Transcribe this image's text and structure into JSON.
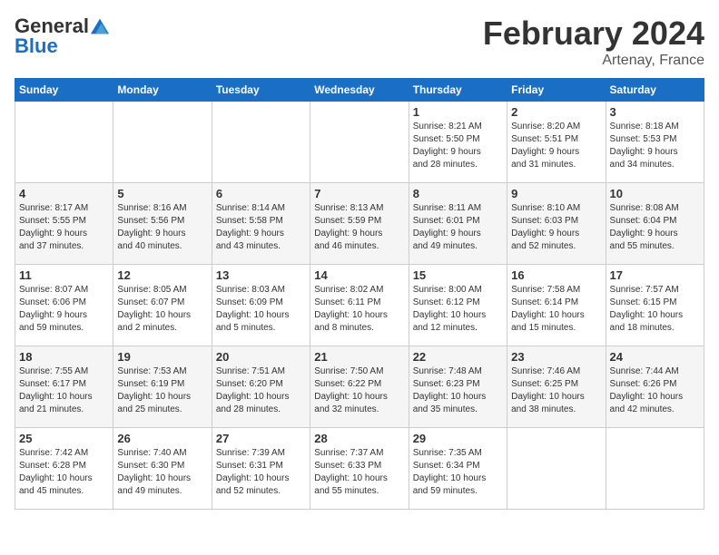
{
  "header": {
    "logo_line1": "General",
    "logo_line2": "Blue",
    "month_title": "February 2024",
    "location": "Artenay, France"
  },
  "days_of_week": [
    "Sunday",
    "Monday",
    "Tuesday",
    "Wednesday",
    "Thursday",
    "Friday",
    "Saturday"
  ],
  "weeks": [
    [
      {
        "day": "",
        "info": ""
      },
      {
        "day": "",
        "info": ""
      },
      {
        "day": "",
        "info": ""
      },
      {
        "day": "",
        "info": ""
      },
      {
        "day": "1",
        "info": "Sunrise: 8:21 AM\nSunset: 5:50 PM\nDaylight: 9 hours\nand 28 minutes."
      },
      {
        "day": "2",
        "info": "Sunrise: 8:20 AM\nSunset: 5:51 PM\nDaylight: 9 hours\nand 31 minutes."
      },
      {
        "day": "3",
        "info": "Sunrise: 8:18 AM\nSunset: 5:53 PM\nDaylight: 9 hours\nand 34 minutes."
      }
    ],
    [
      {
        "day": "4",
        "info": "Sunrise: 8:17 AM\nSunset: 5:55 PM\nDaylight: 9 hours\nand 37 minutes."
      },
      {
        "day": "5",
        "info": "Sunrise: 8:16 AM\nSunset: 5:56 PM\nDaylight: 9 hours\nand 40 minutes."
      },
      {
        "day": "6",
        "info": "Sunrise: 8:14 AM\nSunset: 5:58 PM\nDaylight: 9 hours\nand 43 minutes."
      },
      {
        "day": "7",
        "info": "Sunrise: 8:13 AM\nSunset: 5:59 PM\nDaylight: 9 hours\nand 46 minutes."
      },
      {
        "day": "8",
        "info": "Sunrise: 8:11 AM\nSunset: 6:01 PM\nDaylight: 9 hours\nand 49 minutes."
      },
      {
        "day": "9",
        "info": "Sunrise: 8:10 AM\nSunset: 6:03 PM\nDaylight: 9 hours\nand 52 minutes."
      },
      {
        "day": "10",
        "info": "Sunrise: 8:08 AM\nSunset: 6:04 PM\nDaylight: 9 hours\nand 55 minutes."
      }
    ],
    [
      {
        "day": "11",
        "info": "Sunrise: 8:07 AM\nSunset: 6:06 PM\nDaylight: 9 hours\nand 59 minutes."
      },
      {
        "day": "12",
        "info": "Sunrise: 8:05 AM\nSunset: 6:07 PM\nDaylight: 10 hours\nand 2 minutes."
      },
      {
        "day": "13",
        "info": "Sunrise: 8:03 AM\nSunset: 6:09 PM\nDaylight: 10 hours\nand 5 minutes."
      },
      {
        "day": "14",
        "info": "Sunrise: 8:02 AM\nSunset: 6:11 PM\nDaylight: 10 hours\nand 8 minutes."
      },
      {
        "day": "15",
        "info": "Sunrise: 8:00 AM\nSunset: 6:12 PM\nDaylight: 10 hours\nand 12 minutes."
      },
      {
        "day": "16",
        "info": "Sunrise: 7:58 AM\nSunset: 6:14 PM\nDaylight: 10 hours\nand 15 minutes."
      },
      {
        "day": "17",
        "info": "Sunrise: 7:57 AM\nSunset: 6:15 PM\nDaylight: 10 hours\nand 18 minutes."
      }
    ],
    [
      {
        "day": "18",
        "info": "Sunrise: 7:55 AM\nSunset: 6:17 PM\nDaylight: 10 hours\nand 21 minutes."
      },
      {
        "day": "19",
        "info": "Sunrise: 7:53 AM\nSunset: 6:19 PM\nDaylight: 10 hours\nand 25 minutes."
      },
      {
        "day": "20",
        "info": "Sunrise: 7:51 AM\nSunset: 6:20 PM\nDaylight: 10 hours\nand 28 minutes."
      },
      {
        "day": "21",
        "info": "Sunrise: 7:50 AM\nSunset: 6:22 PM\nDaylight: 10 hours\nand 32 minutes."
      },
      {
        "day": "22",
        "info": "Sunrise: 7:48 AM\nSunset: 6:23 PM\nDaylight: 10 hours\nand 35 minutes."
      },
      {
        "day": "23",
        "info": "Sunrise: 7:46 AM\nSunset: 6:25 PM\nDaylight: 10 hours\nand 38 minutes."
      },
      {
        "day": "24",
        "info": "Sunrise: 7:44 AM\nSunset: 6:26 PM\nDaylight: 10 hours\nand 42 minutes."
      }
    ],
    [
      {
        "day": "25",
        "info": "Sunrise: 7:42 AM\nSunset: 6:28 PM\nDaylight: 10 hours\nand 45 minutes."
      },
      {
        "day": "26",
        "info": "Sunrise: 7:40 AM\nSunset: 6:30 PM\nDaylight: 10 hours\nand 49 minutes."
      },
      {
        "day": "27",
        "info": "Sunrise: 7:39 AM\nSunset: 6:31 PM\nDaylight: 10 hours\nand 52 minutes."
      },
      {
        "day": "28",
        "info": "Sunrise: 7:37 AM\nSunset: 6:33 PM\nDaylight: 10 hours\nand 55 minutes."
      },
      {
        "day": "29",
        "info": "Sunrise: 7:35 AM\nSunset: 6:34 PM\nDaylight: 10 hours\nand 59 minutes."
      },
      {
        "day": "",
        "info": ""
      },
      {
        "day": "",
        "info": ""
      }
    ]
  ]
}
